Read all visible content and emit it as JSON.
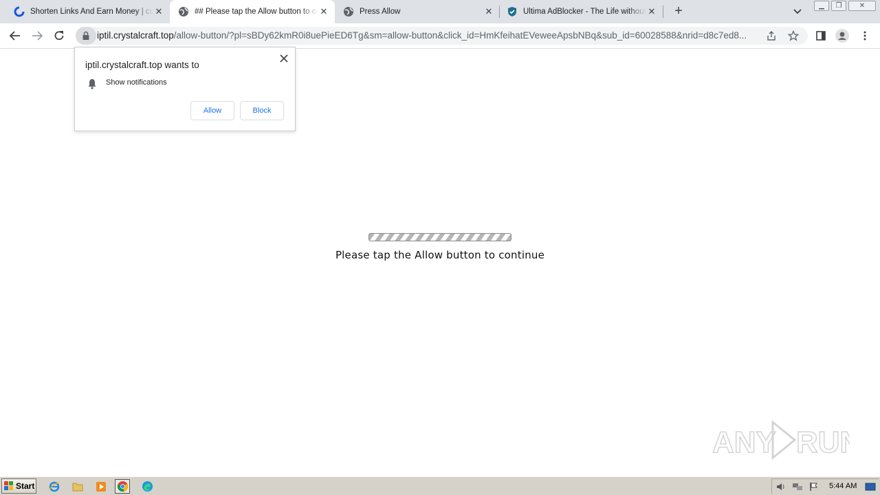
{
  "tabs": [
    {
      "title": "Shorten Links And Earn Money | cuty",
      "favicon": "cuty-c-icon",
      "active": false
    },
    {
      "title": "## Please tap the Allow button to continue",
      "favicon": "globe-icon",
      "active": true
    },
    {
      "title": "Press Allow",
      "favicon": "globe-icon",
      "active": false
    },
    {
      "title": "Ultima AdBlocker - The Life without Ads",
      "favicon": "shield-check-icon",
      "active": false
    }
  ],
  "toolbar": {
    "url_host": "iptil.crystalcraft.top",
    "url_path": "/allow-button/?pl=sBDy62kmR0i8uePieED6Tg&sm=allow-button&click_id=HmKfeihatEVeweeApsbNBq&sub_id=60028588&nrid=d8c7ed8..."
  },
  "permission_prompt": {
    "title": "iptil.crystalcraft.top wants to",
    "permission": "Show notifications",
    "allow_label": "Allow",
    "block_label": "Block"
  },
  "page": {
    "message": "Please tap the Allow button to continue"
  },
  "watermark": {
    "text": "ANY RUN"
  },
  "taskbar": {
    "start_label": "Start",
    "clock": "5:44 AM"
  },
  "colors": {
    "tabstrip_bg": "#dee1e6",
    "link_blue": "#1a73e8",
    "taskbar_bg": "#d6d2c9"
  }
}
